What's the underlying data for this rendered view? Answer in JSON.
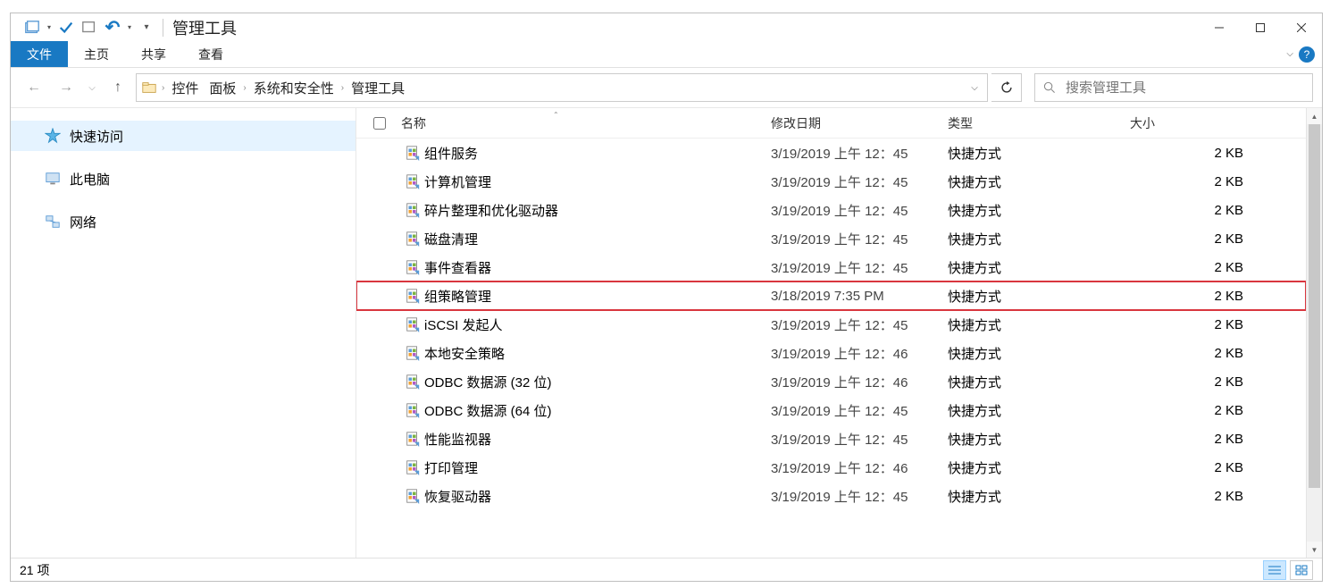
{
  "window": {
    "title": "管理工具"
  },
  "ribbon": {
    "file": "文件",
    "home": "主页",
    "share": "共享",
    "view": "查看"
  },
  "breadcrumbs": [
    "控件",
    "面板",
    "系统和安全性",
    "管理工具"
  ],
  "search": {
    "placeholder": "搜索管理工具"
  },
  "sidebar": {
    "quick": "快速访问",
    "pc": "此电脑",
    "net": "网络"
  },
  "columns": {
    "name": "名称",
    "date": "修改日期",
    "type": "类型",
    "size": "大小"
  },
  "type_label": "快捷方式",
  "size_label": "2 KB",
  "items": [
    {
      "name": "组件服务",
      "date": "3/19/2019 上午 12：45",
      "hl": false
    },
    {
      "name": "计算机管理",
      "date": "3/19/2019 上午 12：45",
      "hl": false
    },
    {
      "name": "碎片整理和优化驱动器",
      "date": "3/19/2019 上午 12：45",
      "hl": false
    },
    {
      "name": "磁盘清理",
      "date": "3/19/2019 上午 12：45",
      "hl": false
    },
    {
      "name": "事件查看器",
      "date": "3/19/2019 上午 12：45",
      "hl": false
    },
    {
      "name": "组策略管理",
      "date": "3/18/2019 7:35 PM",
      "hl": true
    },
    {
      "name": "iSCSI 发起人",
      "date": "3/19/2019 上午 12：45",
      "hl": false
    },
    {
      "name": "本地安全策略",
      "date": "3/19/2019 上午 12：46",
      "hl": false
    },
    {
      "name": "ODBC 数据源 (32 位)",
      "date": "3/19/2019 上午 12：46",
      "hl": false
    },
    {
      "name": "ODBC 数据源 (64 位)",
      "date": "3/19/2019 上午 12：45",
      "hl": false
    },
    {
      "name": "性能监视器",
      "date": "3/19/2019 上午 12：45",
      "hl": false
    },
    {
      "name": "打印管理",
      "date": "3/19/2019 上午 12：46",
      "hl": false
    },
    {
      "name": "恢复驱动器",
      "date": "3/19/2019 上午 12：45",
      "hl": false
    }
  ],
  "status": {
    "count": "21 项"
  }
}
